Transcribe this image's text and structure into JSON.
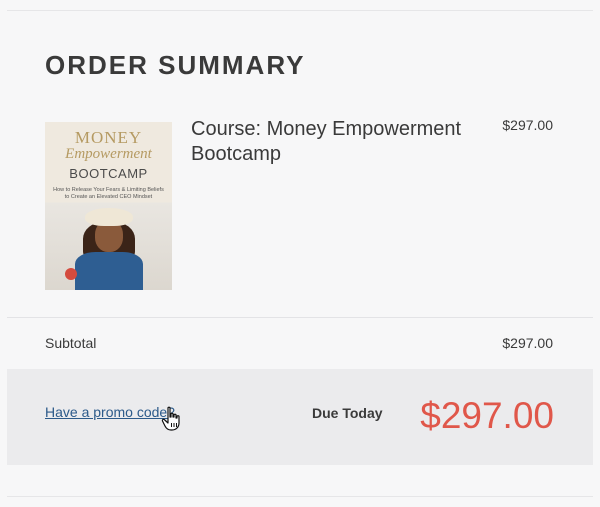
{
  "order": {
    "title": "ORDER SUMMARY",
    "item": {
      "name": "Course: Money Empowerment Bootcamp",
      "price": "$297.00",
      "thumbnail": {
        "line1": "MONEY",
        "line2": "Empowerment",
        "line3": "BOOTCAMP",
        "tagline": "How to Release Your Fears & Limiting Beliefs to Create an Elevated CEO Mindset"
      }
    },
    "subtotal_label": "Subtotal",
    "subtotal_value": "$297.00",
    "promo_link": "Have a promo code?",
    "due_label": "Due Today",
    "due_amount": "$297.00"
  },
  "colors": {
    "accent_due": "#e0574a",
    "link": "#2c5a8a"
  },
  "icons": {
    "cursor": "hand-pointer-icon"
  }
}
